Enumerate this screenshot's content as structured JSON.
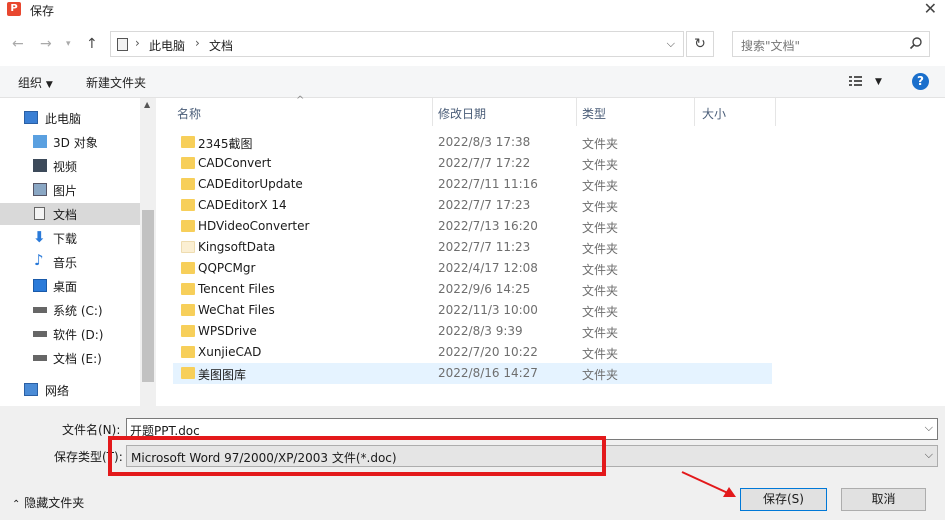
{
  "window": {
    "title": "保存",
    "app_icon_letter": "P"
  },
  "address": {
    "breadcrumbs": [
      "此电脑",
      "文档"
    ],
    "search_placeholder": "搜索\"文档\""
  },
  "toolbar": {
    "organize": "组织",
    "new_folder": "新建文件夹"
  },
  "nav": {
    "items": [
      {
        "label": "此电脑",
        "icon": "pc-icon"
      },
      {
        "label": "3D 对象",
        "icon": "3d-objects-icon"
      },
      {
        "label": "视频",
        "icon": "video-icon"
      },
      {
        "label": "图片",
        "icon": "picture-icon"
      },
      {
        "label": "文档",
        "icon": "document-icon",
        "selected": true
      },
      {
        "label": "下载",
        "icon": "download-icon"
      },
      {
        "label": "音乐",
        "icon": "music-icon"
      },
      {
        "label": "桌面",
        "icon": "desktop-icon"
      },
      {
        "label": "系统 (C:)",
        "icon": "drive-icon"
      },
      {
        "label": "软件 (D:)",
        "icon": "drive-icon"
      },
      {
        "label": "文档 (E:)",
        "icon": "drive-icon"
      },
      {
        "label": "网络",
        "icon": "network-icon"
      }
    ]
  },
  "columns": {
    "name": "名称",
    "modified": "修改日期",
    "type": "类型",
    "size": "大小"
  },
  "files": [
    {
      "name": "2345截图",
      "date": "2022/8/3 17:38",
      "type": "文件夹"
    },
    {
      "name": "CADConvert",
      "date": "2022/7/7 17:22",
      "type": "文件夹"
    },
    {
      "name": "CADEditorUpdate",
      "date": "2022/7/11 11:16",
      "type": "文件夹"
    },
    {
      "name": "CADEditorX 14",
      "date": "2022/7/7 17:23",
      "type": "文件夹"
    },
    {
      "name": "HDVideoConverter",
      "date": "2022/7/13 16:20",
      "type": "文件夹"
    },
    {
      "name": "KingsoftData",
      "date": "2022/7/7 11:23",
      "type": "文件夹",
      "pale": true
    },
    {
      "name": "QQPCMgr",
      "date": "2022/4/17 12:08",
      "type": "文件夹"
    },
    {
      "name": "Tencent Files",
      "date": "2022/9/6 14:25",
      "type": "文件夹"
    },
    {
      "name": "WeChat Files",
      "date": "2022/11/3 10:00",
      "type": "文件夹"
    },
    {
      "name": "WPSDrive",
      "date": "2022/8/3 9:39",
      "type": "文件夹"
    },
    {
      "name": "XunjieCAD",
      "date": "2022/7/20 10:22",
      "type": "文件夹"
    },
    {
      "name": "美图图库",
      "date": "2022/8/16 14:27",
      "type": "文件夹",
      "selected": true
    }
  ],
  "form": {
    "filename_label": "文件名(N):",
    "filename_value": "开题PPT.doc",
    "filetype_label": "保存类型(T):",
    "filetype_value": "Microsoft Word 97/2000/XP/2003 文件(*.doc)"
  },
  "footer": {
    "hide_folders": "隐藏文件夹",
    "save_button": "保存(S)",
    "cancel_button": "取消"
  },
  "colors": {
    "highlight_red": "#e3191b",
    "help_blue": "#1a6fcc",
    "folder_yellow": "#f7cf5a",
    "selection_blue": "#e5f3ff"
  }
}
